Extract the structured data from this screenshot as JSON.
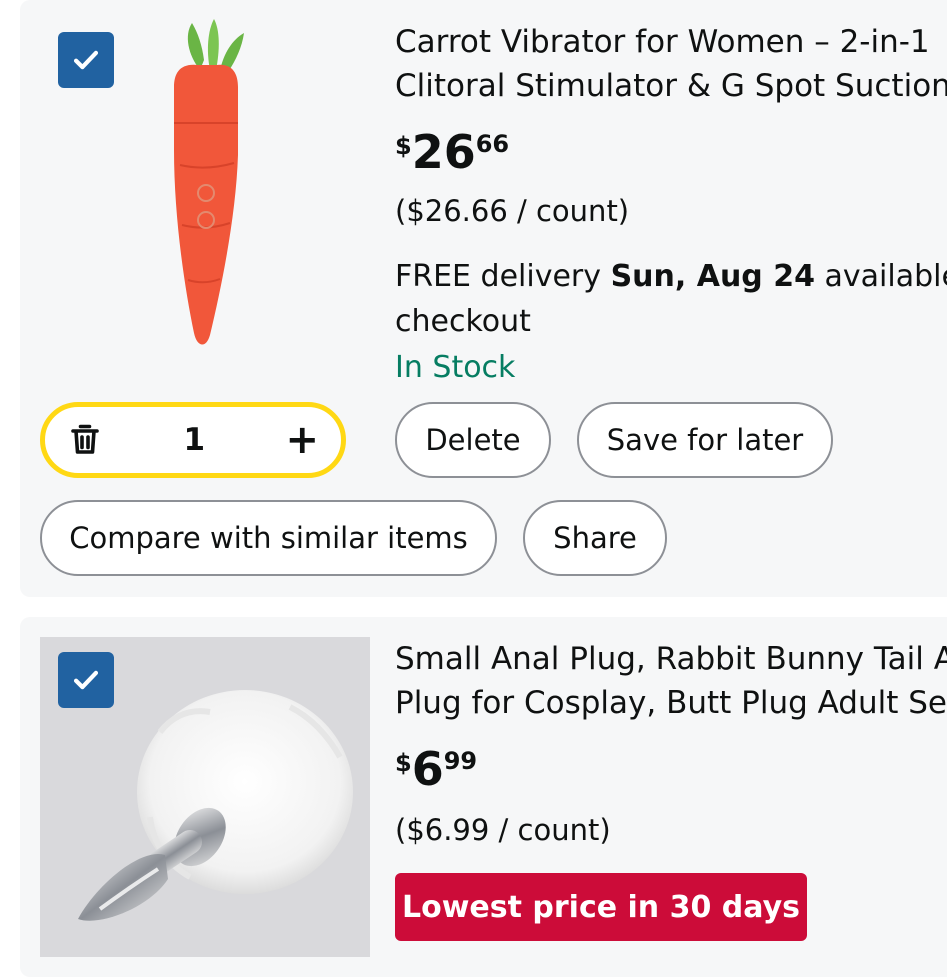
{
  "items": [
    {
      "selected": true,
      "title_line1": "Carrot Vibrator for Women – 2-in-1",
      "title_line2": "Clitoral Stimulator & G Spot Suction",
      "price_symbol": "$",
      "price_whole": "26",
      "price_fraction": "66",
      "unit_price": "($26.66 / count)",
      "delivery_prefix": "FREE delivery ",
      "delivery_date": "Sun, Aug 24",
      "delivery_suffix": " available",
      "delivery_line2": "checkout",
      "stock": "In Stock",
      "quantity": "1",
      "actions": {
        "delete": "Delete",
        "save_for_later": "Save for later",
        "compare": "Compare with similar items",
        "share": "Share"
      }
    },
    {
      "selected": true,
      "title_line1": "Small Anal Plug, Rabbit Bunny Tail A",
      "title_line2": "Plug for Cosplay, Butt Plug Adult Se",
      "price_symbol": "$",
      "price_whole": "6",
      "price_fraction": "99",
      "unit_price": "($6.99 / count)",
      "deal_badge": "Lowest price in 30 days"
    }
  ],
  "colors": {
    "checkbox": "#2162a1",
    "in_stock": "#067d62",
    "qty_border": "#ffd814",
    "deal_badge": "#cc0c39"
  },
  "icons": [
    "checkmark-icon",
    "trash-icon",
    "plus-icon"
  ]
}
